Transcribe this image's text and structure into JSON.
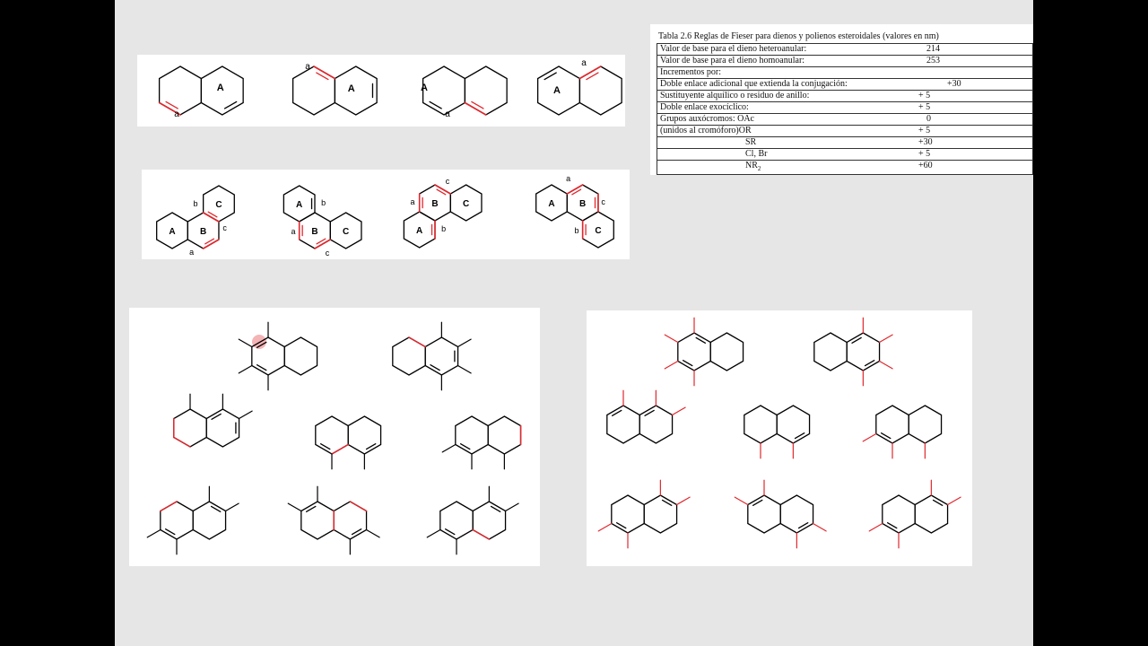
{
  "table": {
    "caption": "Tabla 2.6 Reglas de Fieser para dienos y polienos esteroidales (valores en nm)",
    "rows": [
      {
        "label": "Valor de base para el dieno heteroanular:",
        "value": "214",
        "off": 300
      },
      {
        "label": "Valor de base para el dieno homoanular:",
        "value": "253",
        "off": 300
      },
      {
        "label": "Incrementos por:",
        "value": "",
        "off": 0
      },
      {
        "label": "Doble enlace adicional que extienda la conjugación:",
        "value": "+30",
        "off": 323
      },
      {
        "label": "Sustituyente alquílico o residuo de anillo:",
        "value": "+ 5",
        "off": 291
      },
      {
        "label": "Doble enlace exocíclico:",
        "value": "+ 5",
        "off": 291
      },
      {
        "label": "Grupos auxócromos:  OAc",
        "value": "0",
        "off": 300
      },
      {
        "label": "(unidos al cromóforo)OR",
        "value": "+ 5",
        "off": 291
      },
      {
        "label": "SR",
        "value": "+30",
        "off": 291
      },
      {
        "label": "Cl, Br",
        "value": "+ 5",
        "off": 291
      },
      {
        "label": "NR",
        "sub": "2",
        "value": "+60",
        "off": 291
      }
    ]
  },
  "ring_labels": {
    "A": "A",
    "B": "B",
    "C": "C",
    "a": "a",
    "b": "b",
    "c": "c"
  },
  "colors": {
    "bond": "#000000",
    "highlight": "#e0282e",
    "slide": "#e6e6e6",
    "panel": "#ffffff"
  }
}
